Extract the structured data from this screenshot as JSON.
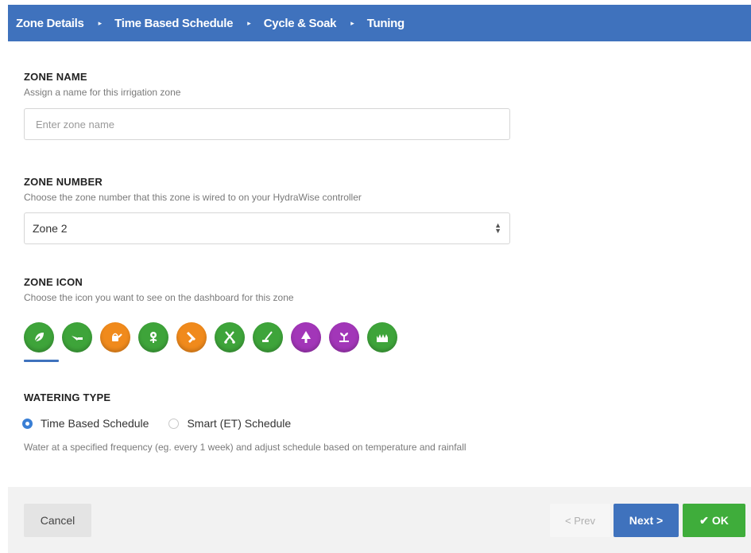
{
  "wizard": {
    "steps": [
      {
        "label": "Zone Details"
      },
      {
        "label": "Time Based Schedule"
      },
      {
        "label": "Cycle & Soak"
      },
      {
        "label": "Tuning"
      }
    ],
    "separator": "▸"
  },
  "zone_name": {
    "title": "ZONE NAME",
    "description": "Assign a name for this irrigation zone",
    "placeholder": "Enter zone name",
    "value": ""
  },
  "zone_number": {
    "title": "ZONE NUMBER",
    "description": "Choose the zone number that this zone is wired to on your HydraWise controller",
    "selected": "Zone 2"
  },
  "zone_icon": {
    "title": "ZONE ICON",
    "description": "Choose the icon you want to see on the dashboard for this zone",
    "selected_index": 0,
    "icons": [
      {
        "name": "leaf-icon",
        "color": "#3ea43a"
      },
      {
        "name": "sprinkler-icon",
        "color": "#3ea43a"
      },
      {
        "name": "watering-can-icon",
        "color": "#f08a1c"
      },
      {
        "name": "flower-icon",
        "color": "#3ea43a"
      },
      {
        "name": "hose-icon",
        "color": "#f08a1c"
      },
      {
        "name": "shears-icon",
        "color": "#3ea43a"
      },
      {
        "name": "rake-icon",
        "color": "#3ea43a"
      },
      {
        "name": "tree-icon",
        "color": "#a236b8"
      },
      {
        "name": "sprout-icon",
        "color": "#a236b8"
      },
      {
        "name": "grass-icon",
        "color": "#3ea43a"
      }
    ]
  },
  "watering_type": {
    "title": "WATERING TYPE",
    "options": [
      {
        "label": "Time Based Schedule",
        "checked": true
      },
      {
        "label": "Smart (ET) Schedule",
        "checked": false
      }
    ],
    "description": "Water at a specified frequency (eg. every 1 week) and adjust schedule based on temperature and rainfall"
  },
  "footer": {
    "cancel_label": "Cancel",
    "prev_label": "< Prev",
    "next_label": "Next >",
    "ok_check": "✔",
    "ok_label": "OK"
  },
  "colors": {
    "accent": "#3f72bd",
    "ok_green": "#3fad3b"
  }
}
